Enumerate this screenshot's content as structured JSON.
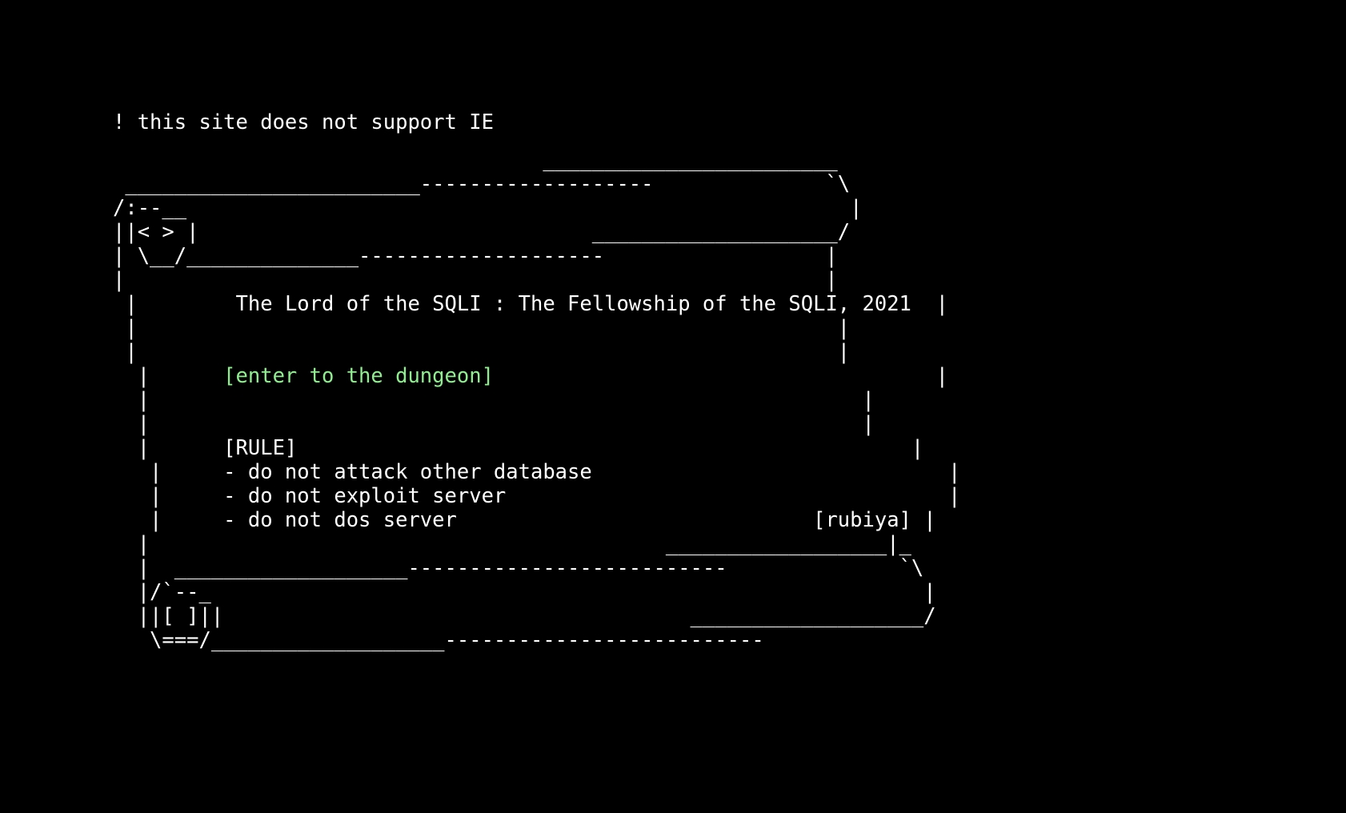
{
  "notice": "! this site does not support IE",
  "scroll": {
    "lines": [
      "                                   ________________________",
      " ________________________-------------------              `\\",
      "/:--__                                                      |",
      "||< > |                                ____________________/",
      "| \\__/______________--------------------                  |",
      "|                                                         |"
    ],
    "title_prefix": " |        ",
    "title": "The Lord of the SQLI : The Fellowship of the SQLI, 2021",
    "title_suffix": "  |",
    "after_title": [
      " |                                                         |",
      " |                                                         |"
    ],
    "link_prefix": "  |      ",
    "link_label": "[enter to the dungeon]",
    "link_suffix": "                                    |",
    "after_link": [
      "  |                                                          |",
      "  |                                                          |"
    ],
    "rule_heading_prefix": "  |      ",
    "rule_heading": "[RULE]",
    "rule_heading_suffix": "                                                  |",
    "rule_prefix": "   |     ",
    "rules": [
      "- do not attack other database",
      "- do not exploit server",
      "- do not dos server"
    ],
    "rule_suffixes": [
      "                             |",
      "                                    |",
      "                             "
    ],
    "author": "[rubiya]",
    "author_suffix": " |",
    "footer_lines": [
      "  |                                          __________________|_",
      "  |  ___________________--------------------------              `\\",
      "  |/`--_                                                          |",
      "  ||[ ]||                                      ___________________/",
      "   \\===/___________________--------------------------"
    ]
  }
}
